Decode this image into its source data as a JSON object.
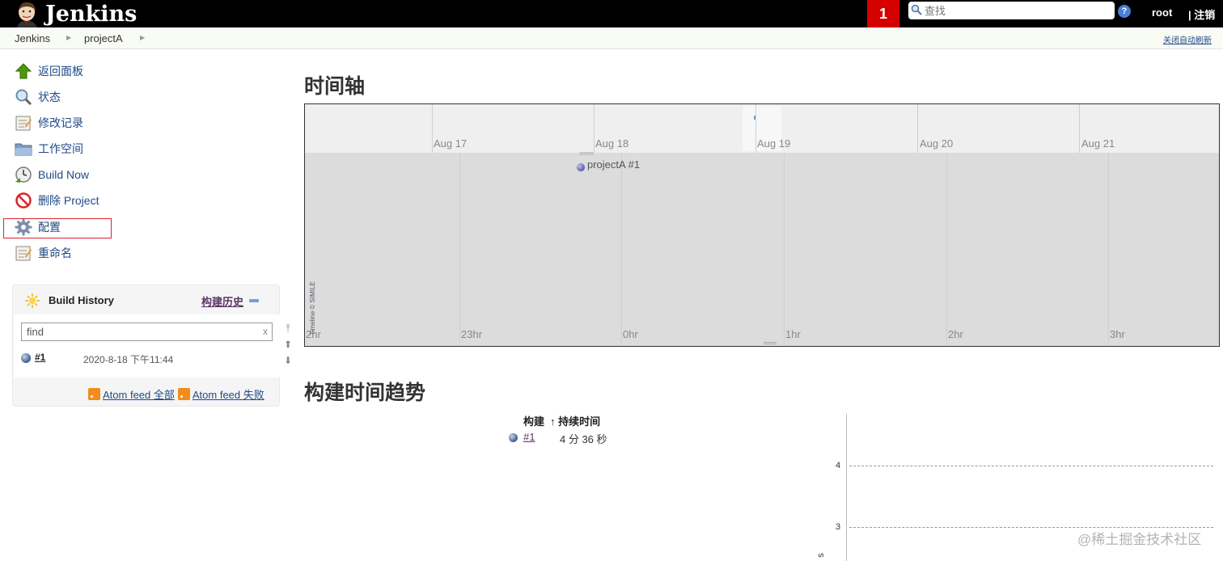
{
  "header": {
    "brand": "Jenkins",
    "notification_count": "1",
    "search_placeholder": "查找",
    "help": "?",
    "user": "root",
    "logout": "| 注销"
  },
  "breadcrumb": {
    "items": [
      "Jenkins",
      "projectA"
    ],
    "auto_refresh": "关闭自动刷新"
  },
  "sidebar": {
    "tasks": [
      {
        "label": "返回面板",
        "icon": "up-arrow-icon"
      },
      {
        "label": "状态",
        "icon": "magnifier-icon"
      },
      {
        "label": "修改记录",
        "icon": "notepad-icon"
      },
      {
        "label": "工作空间",
        "icon": "folder-icon"
      },
      {
        "label": "Build Now",
        "icon": "clock-icon"
      },
      {
        "label": "删除 Project",
        "icon": "no-entry-icon"
      },
      {
        "label": "配置",
        "icon": "gear-icon"
      },
      {
        "label": "重命名",
        "icon": "notepad-icon"
      }
    ]
  },
  "build_history": {
    "title": "Build History",
    "trend_link": "构建历史",
    "filter_placeholder": "find",
    "filter_clear": "x",
    "builds": [
      {
        "number": "#1",
        "date": "2020-8-18 下午11:44"
      }
    ],
    "feed_all": "Atom feed 全部",
    "feed_failed": "Atom feed 失败"
  },
  "main": {
    "timeline_title": "时间轴",
    "timeline": {
      "date_labels": [
        "Aug 17",
        "Aug 18",
        "Aug 19",
        "Aug 20",
        "Aug 21"
      ],
      "hour_labels": [
        "2hr",
        "23hr",
        "0hr",
        "1hr",
        "2hr",
        "3hr"
      ],
      "event_label": "projectA #1",
      "credit": "Timeline © SIMILE"
    },
    "trend_title": "构建时间趋势",
    "trend_table": {
      "col_build": "构建",
      "col_duration": "↑ 持续时间",
      "rows": [
        {
          "build": "#1",
          "duration": "4 分 36 秒"
        }
      ]
    }
  },
  "chart_data": {
    "type": "line",
    "y_ticks": [
      "4",
      "3"
    ],
    "ylabel_fragment": "s"
  },
  "watermark": "@稀土掘金技术社区"
}
